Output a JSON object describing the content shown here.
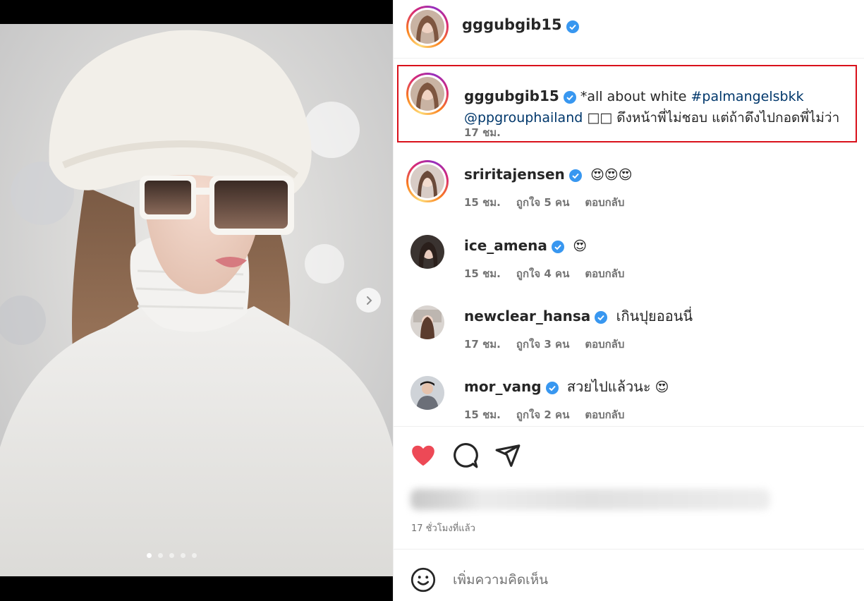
{
  "post": {
    "author": "gggubgib15",
    "carousel": {
      "total_images": 5,
      "current_index": 0
    }
  },
  "caption": {
    "username": "gggubgib15",
    "text_before": "*all about white ",
    "hashtag": "#palmangelsbkk",
    "mention": "@ppgrouphailand",
    "text_after": " □□ ดึงหน้าพี่ไม่ชอบ แต่ถ้าดึงไปกอดพี่ไม่ว่า",
    "time": "17 ชม."
  },
  "comments": [
    {
      "username": "sriritajensen",
      "text": "",
      "emoji": "😍😍😍",
      "time": "15 ชม.",
      "likes": "ถูกใจ 5 คน",
      "reply": "ตอบกลับ"
    },
    {
      "username": "ice_amena",
      "text": "",
      "emoji": "😍",
      "time": "15 ชม.",
      "likes": "ถูกใจ 4 คน",
      "reply": "ตอบกลับ"
    },
    {
      "username": "newclear_hansa",
      "text": "เกินปุยออนนี่",
      "emoji": "",
      "time": "17 ชม.",
      "likes": "ถูกใจ 3 คน",
      "reply": "ตอบกลับ"
    },
    {
      "username": "mor_vang",
      "text": "สวยไปแล้วนะ",
      "emoji": "😍",
      "time": "15 ชม.",
      "likes": "ถูกใจ 2 คน",
      "reply": "ตอบกลับ"
    }
  ],
  "actions": {
    "liked": true,
    "like_color": "#ed4956",
    "icons": [
      "heart-icon",
      "comment-icon",
      "share-icon"
    ]
  },
  "post_time": "17 ชั่วโมงที่แล้ว",
  "add_comment": {
    "placeholder": "เพิ่มความคิดเห็น"
  },
  "colors": {
    "verified": "#3897f0",
    "highlight_box": "#d9111b",
    "link": "#00376b"
  }
}
